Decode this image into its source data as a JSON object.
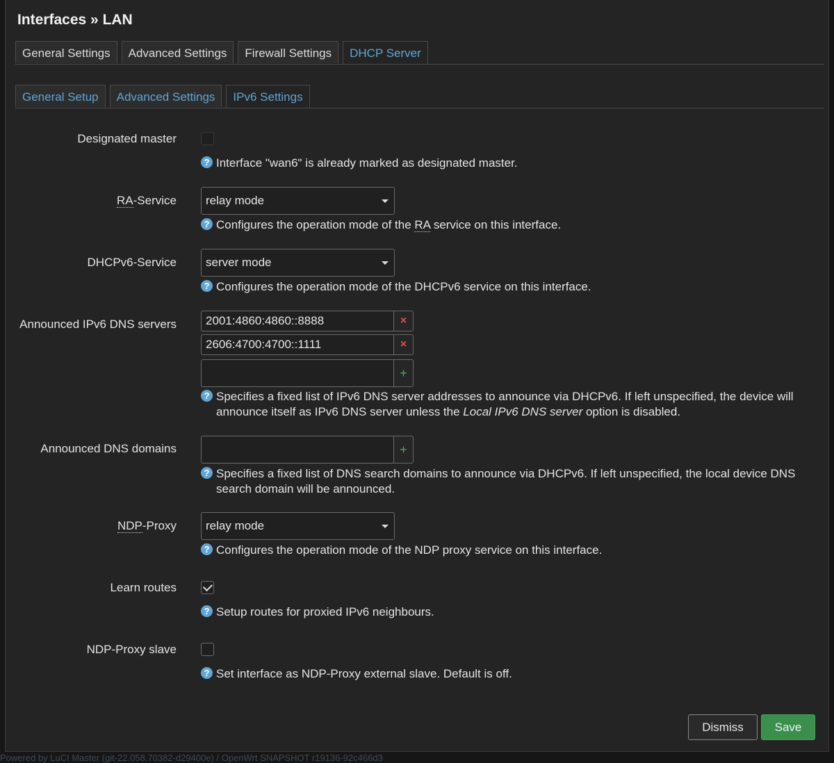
{
  "title": "Interfaces » LAN",
  "tabs": [
    "General Settings",
    "Advanced Settings",
    "Firewall Settings",
    "DHCP Server"
  ],
  "subtabs": [
    "General Setup",
    "Advanced Settings",
    "IPv6 Settings"
  ],
  "icons": {
    "help": "help-circle-icon",
    "remove": "remove-x-icon",
    "add": "add-plus-icon",
    "caret": "chevron-down-icon",
    "check": "check-icon"
  },
  "colors": {
    "accent": "#5fa6d6",
    "save": "#3a8f4d",
    "remove": "#d9534f",
    "add": "#4cae4c"
  },
  "designated_master": {
    "label": "Designated master",
    "checked": false,
    "disabled": true,
    "help": "Interface \"wan6\" is already marked as designated master."
  },
  "ra_service": {
    "label_abbr": "RA",
    "label_rest": "-Service",
    "value": "relay mode",
    "help_pre": "Configures the operation mode of the ",
    "help_abbr": "RA",
    "help_post": " service on this interface."
  },
  "dhcpv6_service": {
    "label": "DHCPv6-Service",
    "value": "server mode",
    "help": "Configures the operation mode of the DHCPv6 service on this interface."
  },
  "dns_servers": {
    "label": "Announced IPv6 DNS servers",
    "values": [
      "2001:4860:4860::8888",
      "2606:4700:4700::1111"
    ],
    "new_value": "",
    "help_pre": "Specifies a fixed list of IPv6 DNS server addresses to announce via DHCPv6. If left unspecified, the device will announce itself as IPv6 DNS server unless the ",
    "help_em": "Local IPv6 DNS server",
    "help_post": " option is disabled.",
    "remove_glyph": "×",
    "add_glyph": "+"
  },
  "dns_domains": {
    "label": "Announced DNS domains",
    "new_value": "",
    "help": "Specifies a fixed list of DNS search domains to announce via DHCPv6. If left unspecified, the local device DNS search domain will be announced.",
    "add_glyph": "+"
  },
  "ndp_proxy": {
    "label_abbr": "NDP",
    "label_rest": "-Proxy",
    "value": "relay mode",
    "help": "Configures the operation mode of the NDP proxy service on this interface."
  },
  "learn_routes": {
    "label": "Learn routes",
    "checked": true,
    "help": "Setup routes for proxied IPv6 neighbours."
  },
  "ndp_proxy_slave": {
    "label": "NDP-Proxy slave",
    "checked": false,
    "help": "Set interface as NDP-Proxy external slave. Default is off."
  },
  "buttons": {
    "dismiss": "Dismiss",
    "save": "Save"
  },
  "help_glyph": "?",
  "footer": "Powered by LuCI Master (git-22.058.70382-d29400e) / OpenWrt SNAPSHOT r19136-92c466d3"
}
